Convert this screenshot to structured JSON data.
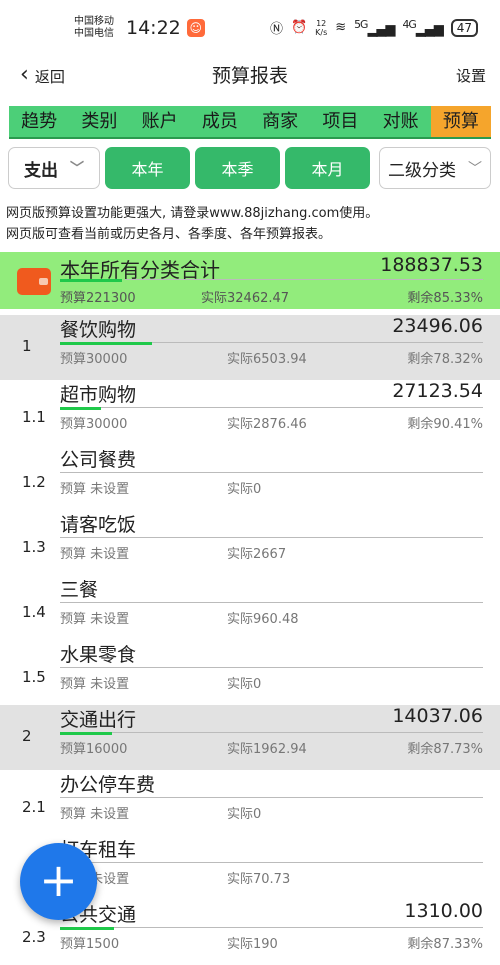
{
  "statusbar": {
    "carrier1": "中国移动",
    "carrier2": "中国电信",
    "time": "14:22",
    "speed_top": "12",
    "speed_unit": "K/s",
    "signal1": "5G",
    "signal2": "4G",
    "battery": "47",
    "icons": [
      "nfc-icon",
      "alarm-icon",
      "wifi-icon",
      "signal-icon",
      "battery-icon"
    ]
  },
  "nav": {
    "back_label": "返回",
    "title": "预算报表",
    "settings_label": "设置"
  },
  "tabs": [
    "趋势",
    "类别",
    "账户",
    "成员",
    "商家",
    "项目",
    "对账",
    "预算"
  ],
  "active_tab": "预算",
  "filters": {
    "type": "支出",
    "periods": [
      "本年",
      "本季",
      "本月"
    ],
    "level": "二级分类"
  },
  "notice": [
    "网页版预算设置功能更强大, 请登录www.88jizhang.com使用。",
    "网页版可查看当前或历史各月、各季度、各年预算报表。"
  ],
  "total": {
    "title": "本年所有分类合计",
    "amount": "188837.53",
    "budget": "预算221300",
    "actual": "实际32462.47",
    "remaining": "剩余85.33%",
    "progress": 0.147
  },
  "rows": [
    {
      "idx": "1",
      "name": "餐饮购物",
      "amount": "23496.06",
      "budget": "预算30000",
      "actual": "实际6503.94",
      "remaining": "剩余78.32%",
      "grey": true,
      "progress": 0.217
    },
    {
      "idx": "1.1",
      "name": "超市购物",
      "amount": "27123.54",
      "budget": "预算30000",
      "actual": "实际2876.46",
      "remaining": "剩余90.41%",
      "grey": false,
      "progress": 0.096
    },
    {
      "idx": "1.2",
      "name": "公司餐费",
      "amount": "",
      "budget": "预算 未设置",
      "actual": "实际0",
      "remaining": "",
      "grey": false,
      "progress": 0
    },
    {
      "idx": "1.3",
      "name": "请客吃饭",
      "amount": "",
      "budget": "预算 未设置",
      "actual": "实际2667",
      "remaining": "",
      "grey": false,
      "progress": 0
    },
    {
      "idx": "1.4",
      "name": "三餐",
      "amount": "",
      "budget": "预算 未设置",
      "actual": "实际960.48",
      "remaining": "",
      "grey": false,
      "progress": 0
    },
    {
      "idx": "1.5",
      "name": "水果零食",
      "amount": "",
      "budget": "预算 未设置",
      "actual": "实际0",
      "remaining": "",
      "grey": false,
      "progress": 0
    },
    {
      "idx": "2",
      "name": "交通出行",
      "amount": "14037.06",
      "budget": "预算16000",
      "actual": "实际1962.94",
      "remaining": "剩余87.73%",
      "grey": true,
      "progress": 0.123
    },
    {
      "idx": "2.1",
      "name": "办公停车费",
      "amount": "",
      "budget": "预算 未设置",
      "actual": "实际0",
      "remaining": "",
      "grey": false,
      "progress": 0
    },
    {
      "idx": "2.2",
      "name": "打车租车",
      "amount": "",
      "budget": "预算 未设置",
      "actual": "实际70.73",
      "remaining": "",
      "grey": false,
      "progress": 0
    },
    {
      "idx": "2.3",
      "name": "公共交通",
      "amount": "1310.00",
      "budget": "预算1500",
      "actual": "实际190",
      "remaining": "剩余87.33%",
      "grey": false,
      "progress": 0.127
    }
  ],
  "fab_label": "+"
}
